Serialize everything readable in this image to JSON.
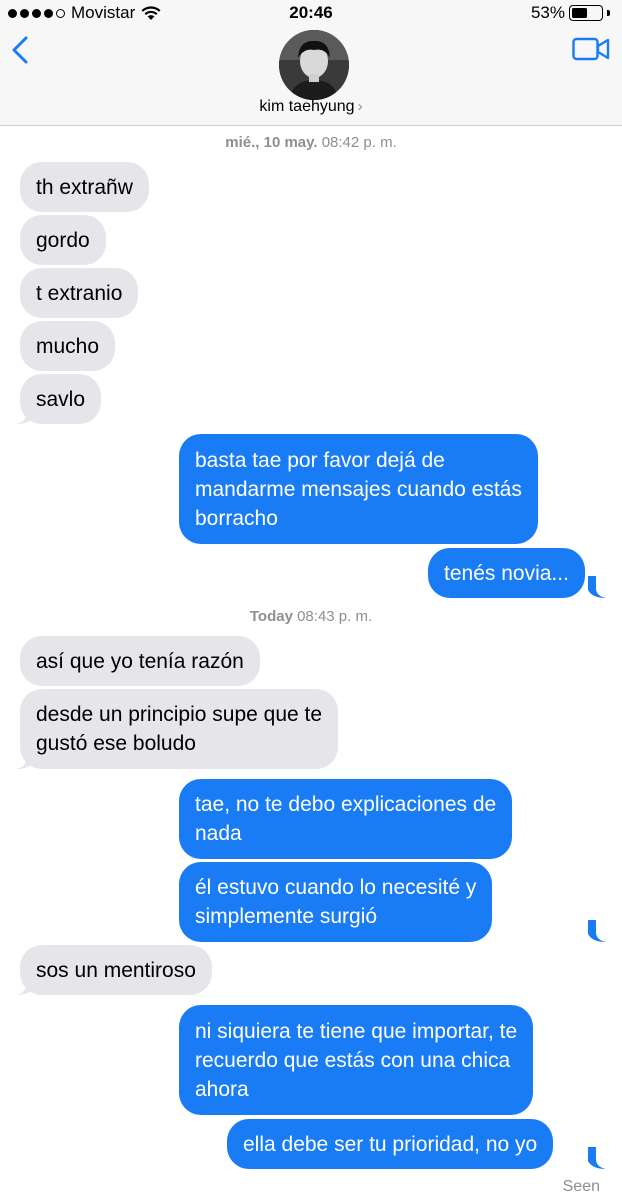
{
  "status_bar": {
    "carrier": "Movistar",
    "time": "20:46",
    "battery_percent": "53%",
    "battery_level": 0.53,
    "signal_bars_filled": 4
  },
  "header": {
    "contact_name": "kim taehyung",
    "back_icon": "chevron-left-icon",
    "video_icon": "video-camera-icon",
    "accent_color": "#1a7cf5"
  },
  "timestamps": [
    {
      "day": "mié., 10 may.",
      "time": "08:42 p. m."
    },
    {
      "day": "Today",
      "time": "08:43 p. m."
    }
  ],
  "messages": [
    {
      "from": "them",
      "lines": [
        "th extrañw"
      ]
    },
    {
      "from": "them",
      "lines": [
        "gordo"
      ]
    },
    {
      "from": "them",
      "lines": [
        "t extranio"
      ]
    },
    {
      "from": "them",
      "lines": [
        "mucho"
      ]
    },
    {
      "from": "them",
      "lines": [
        "savlo"
      ]
    },
    {
      "from": "me",
      "lines": [
        "basta tae por favor dejá de",
        "mandarme mensajes cuando estás",
        "borracho"
      ]
    },
    {
      "from": "me",
      "lines": [
        "tenés novia..."
      ]
    },
    {
      "from": "them",
      "lines": [
        "así que yo tenía razón"
      ]
    },
    {
      "from": "them",
      "lines": [
        "desde un principio supe que te",
        "gustó ese boludo"
      ]
    },
    {
      "from": "me",
      "lines": [
        "tae, no te debo explicaciones de",
        "nada"
      ]
    },
    {
      "from": "me",
      "lines": [
        "él estuvo cuando lo necesité y",
        "simplemente surgió"
      ]
    },
    {
      "from": "them",
      "lines": [
        "sos un mentiroso"
      ]
    },
    {
      "from": "me",
      "lines": [
        "ni siquiera te tiene que importar, te",
        "recuerdo que estás con una chica",
        "ahora"
      ]
    },
    {
      "from": "me",
      "lines": [
        "ella debe ser tu prioridad, no yo"
      ]
    }
  ],
  "seen_label": "Seen",
  "colors": {
    "incoming_bubble": "#e5e5ea",
    "outgoing_bubble": "#1a7cf5",
    "timestamp": "#8e8e93"
  }
}
